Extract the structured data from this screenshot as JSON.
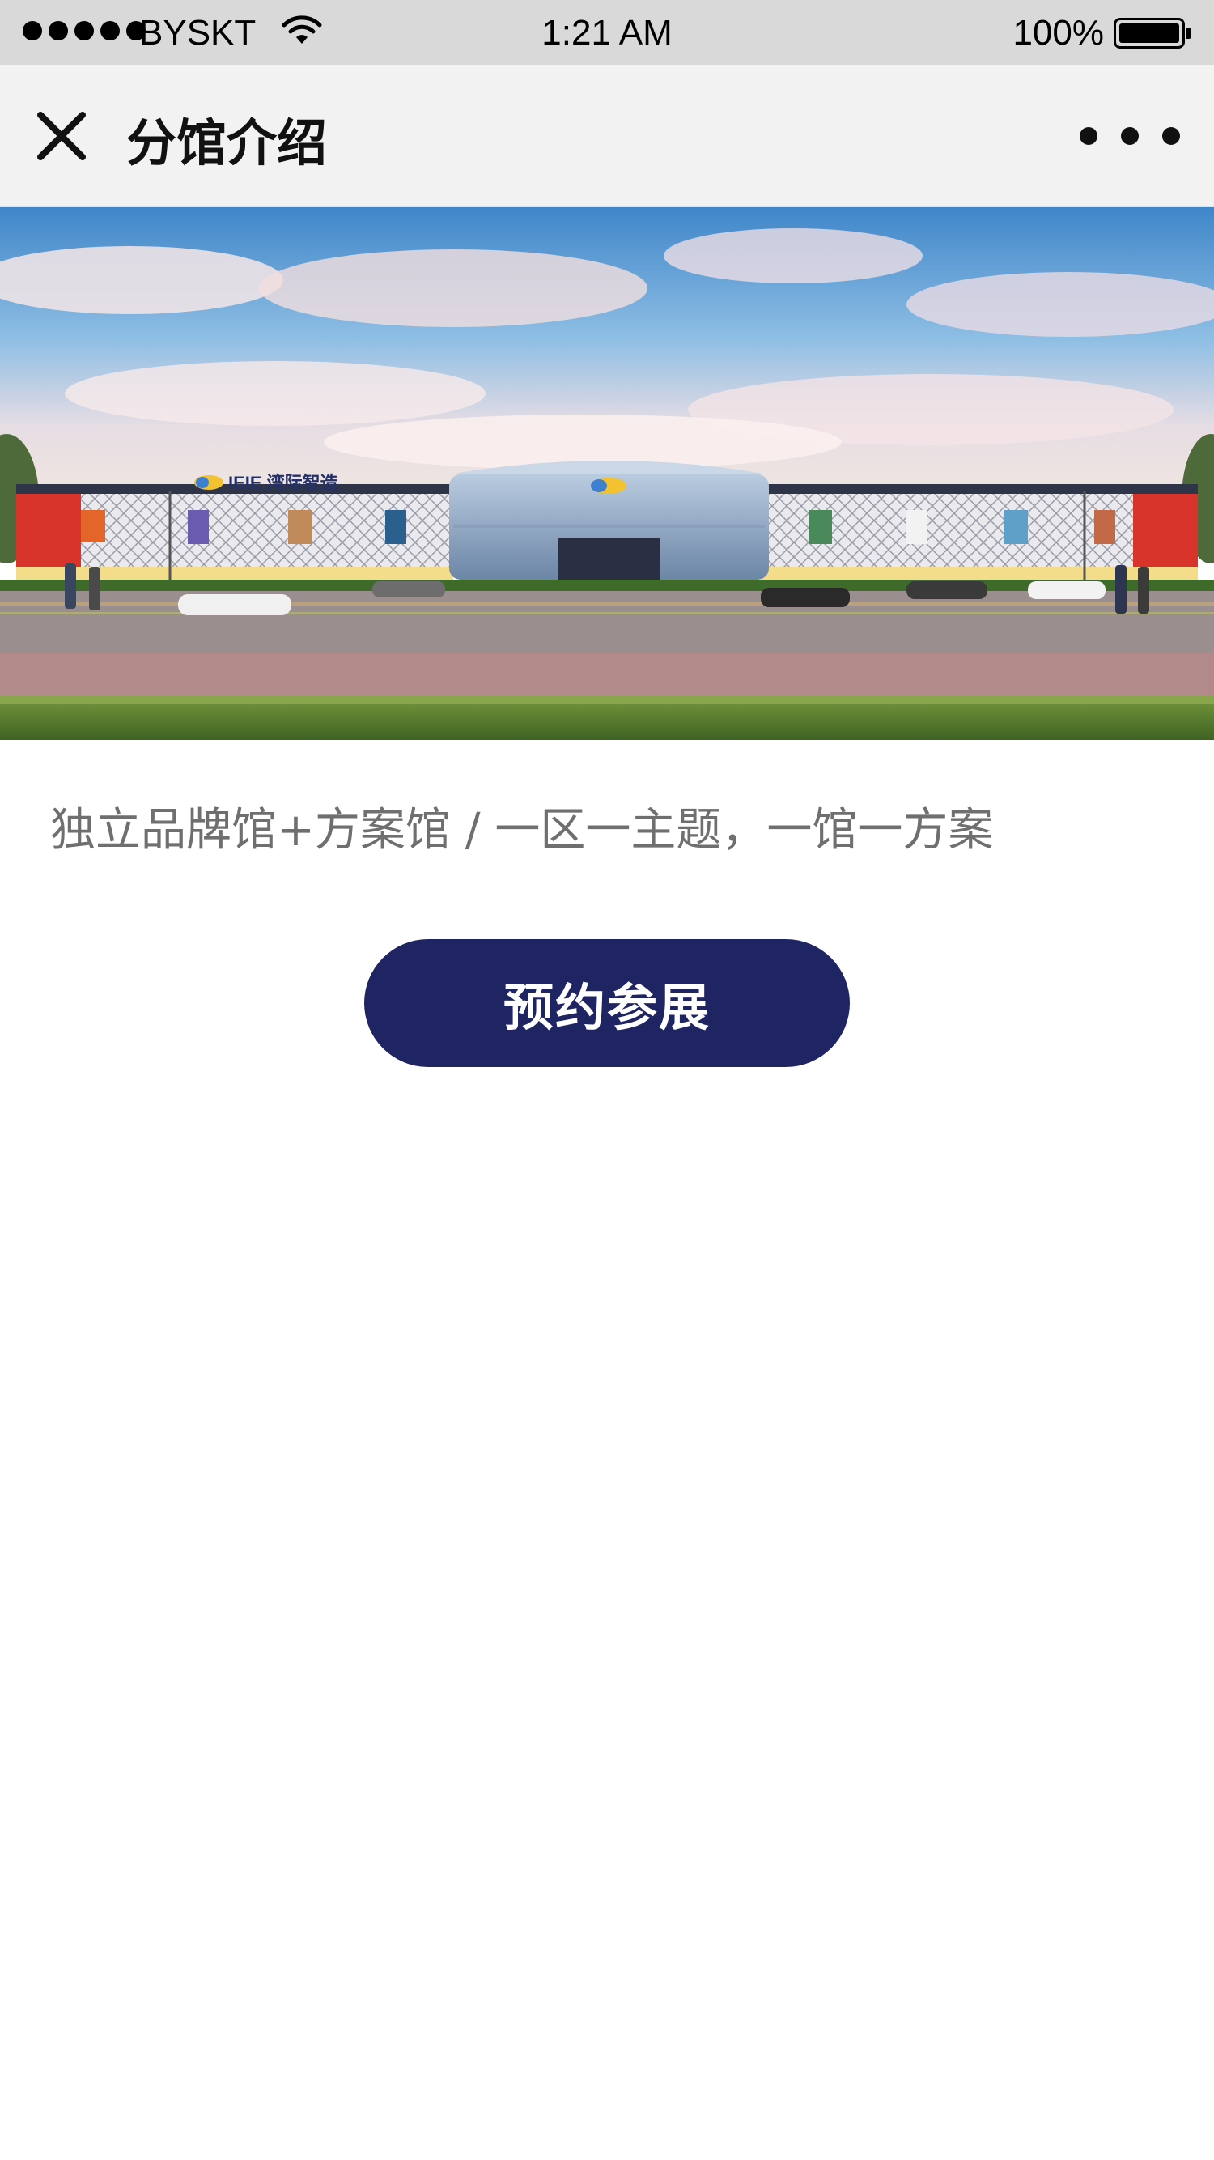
{
  "status_bar": {
    "carrier": "BYSKT",
    "time": "1:21 AM",
    "battery": "100%",
    "battery_level": 1.0
  },
  "nav": {
    "title": "分馆介绍",
    "close_icon": "close-icon",
    "more_icon": "more-icon"
  },
  "hero": {
    "description": "exhibition center building photo",
    "sign_text": "IEIE 湾际智造"
  },
  "content": {
    "tagline": "独立品牌馆+方案馆  /  一区一主题，一馆一方案",
    "cta_label": "预约参展"
  },
  "colors": {
    "status_bg": "#d9d9d9",
    "nav_bg": "#f2f2f2",
    "cta_bg": "#1f2462",
    "tagline_text": "#6f6f6f"
  }
}
